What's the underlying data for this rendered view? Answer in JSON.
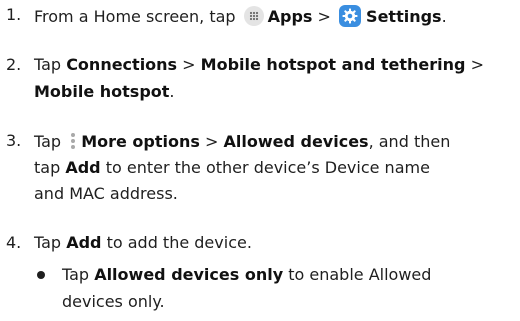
{
  "steps": [
    {
      "number": "1.",
      "text_a": "From a Home screen, tap",
      "apps_label": "Apps",
      "sep": ">",
      "settings_label": "Settings",
      "end": "."
    },
    {
      "number": "2.",
      "text_a": "Tap",
      "connections_label": "Connections",
      "sep1": ">",
      "hotspot_tethering_label": "Mobile hotspot and tethering",
      "sep2": ">",
      "hotspot_label": "Mobile hotspot",
      "end": "."
    },
    {
      "number": "3.",
      "text_a": "Tap",
      "more_options_label": "More options",
      "sep": ">",
      "allowed_devices_label": "Allowed devices",
      "text_b": ", and then",
      "text_c": "tap",
      "add_label": "Add",
      "text_d": "to enter the other device’s Device name",
      "text_e": "and MAC address."
    },
    {
      "number": "4.",
      "text_a": "Tap",
      "add_label": "Add",
      "text_b": "to add the device."
    }
  ],
  "bullet_item": {
    "text_a": "Tap",
    "allowed_only_label": "Allowed devices only",
    "text_b": "to enable Allowed",
    "text_c": "devices only."
  },
  "icons": {
    "apps": "apps-grid-icon",
    "settings": "gear-icon",
    "more_options": "vertical-dots-icon"
  },
  "colors": {
    "text": "#1f1f1f",
    "settings_icon_bg": "#3a8ee0",
    "apps_icon_bg": "#e4e4e4"
  }
}
